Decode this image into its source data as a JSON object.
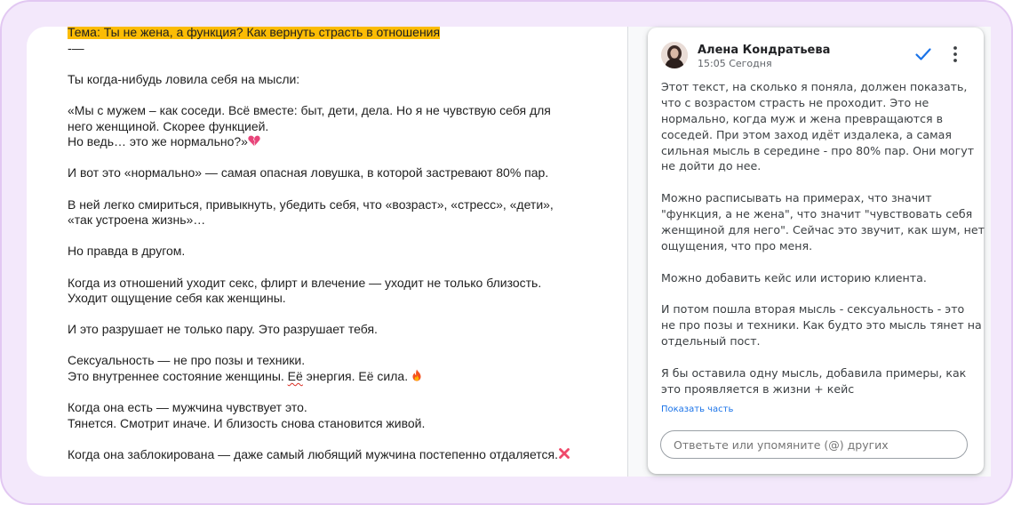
{
  "document": {
    "title": "Тема: Ты не жена, а функция? Как вернуть страсть в отношения",
    "separator": "-—",
    "paragraphs": [
      [
        "Ты когда-нибудь ловила себя на мысли:"
      ],
      [
        "«Мы с мужем – как соседи. Всё вместе: быт, дети, дела. Но я не чувствую себя для",
        "него женщиной. Скорее функцией.",
        "Но ведь… это же нормально?»"
      ],
      [
        "И вот это «нормально» — самая опасная ловушка, в которой застревают 80% пар."
      ],
      [
        "В ней легко смириться, привыкнуть, убедить себя, что «возраст», «стресс», «дети»,",
        "«так устроена жизнь»…"
      ],
      [
        "Но правда в другом."
      ],
      [
        "Когда из отношений уходит секс, флирт и влечение — уходит не только близость.",
        "Уходит ощущение себя как женщины."
      ],
      [
        "И это разрушает не только пару. Это разрушает тебя."
      ],
      [
        "Сексуальность — не про позы и техники."
      ],
      [
        "Когда она есть — мужчина чувствует это.",
        "Тянется. Смотрит иначе. И близость снова становится живой."
      ],
      [
        "Когда она заблокирована — даже самый любящий мужчина постепенно отдаляется."
      ]
    ],
    "energy_line": {
      "before": "Это внутреннее состояние женщины. ",
      "misspelled": "Её",
      "after": " энергия. Её сила."
    },
    "emojis": {
      "broken_heart": "broken-heart-icon",
      "fire": "fire-icon",
      "cross_mark": "cross-mark-icon"
    }
  },
  "comment": {
    "author": "Алена Кондратьева",
    "time": "15:05 Сегодня",
    "paragraphs": [
      [
        "Этот текст, на сколько я поняла, должен показать,",
        "что с возрастом страсть не проходит. Это не",
        "нормально, когда муж и жена превращаются в",
        "соседей. При этом заход идёт издалека, а самая",
        "сильная мысль в середине - про 80% пар. Они могут",
        "не дойти до нее."
      ],
      [
        "Можно расписывать на примерах, что значит",
        "\"функция, а не жена\", что значит \"чувствовать себя",
        "женщиной для него\". Сейчас это звучит, как шум, нет",
        "ощущения, что про меня."
      ],
      [
        "Можно добавить кейс или историю клиента."
      ],
      [
        "И потом пошла вторая мысль - сексуальность - это",
        "не про позы и техники. Как будто это мысль тянет на",
        "отдельный пост."
      ],
      [
        "Я бы оставила одну мысль, добавила примеры, как",
        "это проявляется в жизни + кейс"
      ]
    ],
    "show_more": "Показать часть",
    "reply_placeholder": "Ответьте или упомяните (@) других",
    "icons": {
      "resolve": "checkmark-icon",
      "more": "more-vertical-icon",
      "avatar": "avatar"
    }
  },
  "colors": {
    "frame_bg": "#f3e8fb",
    "frame_border": "#e2c8f2",
    "title_highlight": "#fbbc04",
    "accent_blue": "#1a73e8",
    "spell_error": "#d93025"
  }
}
